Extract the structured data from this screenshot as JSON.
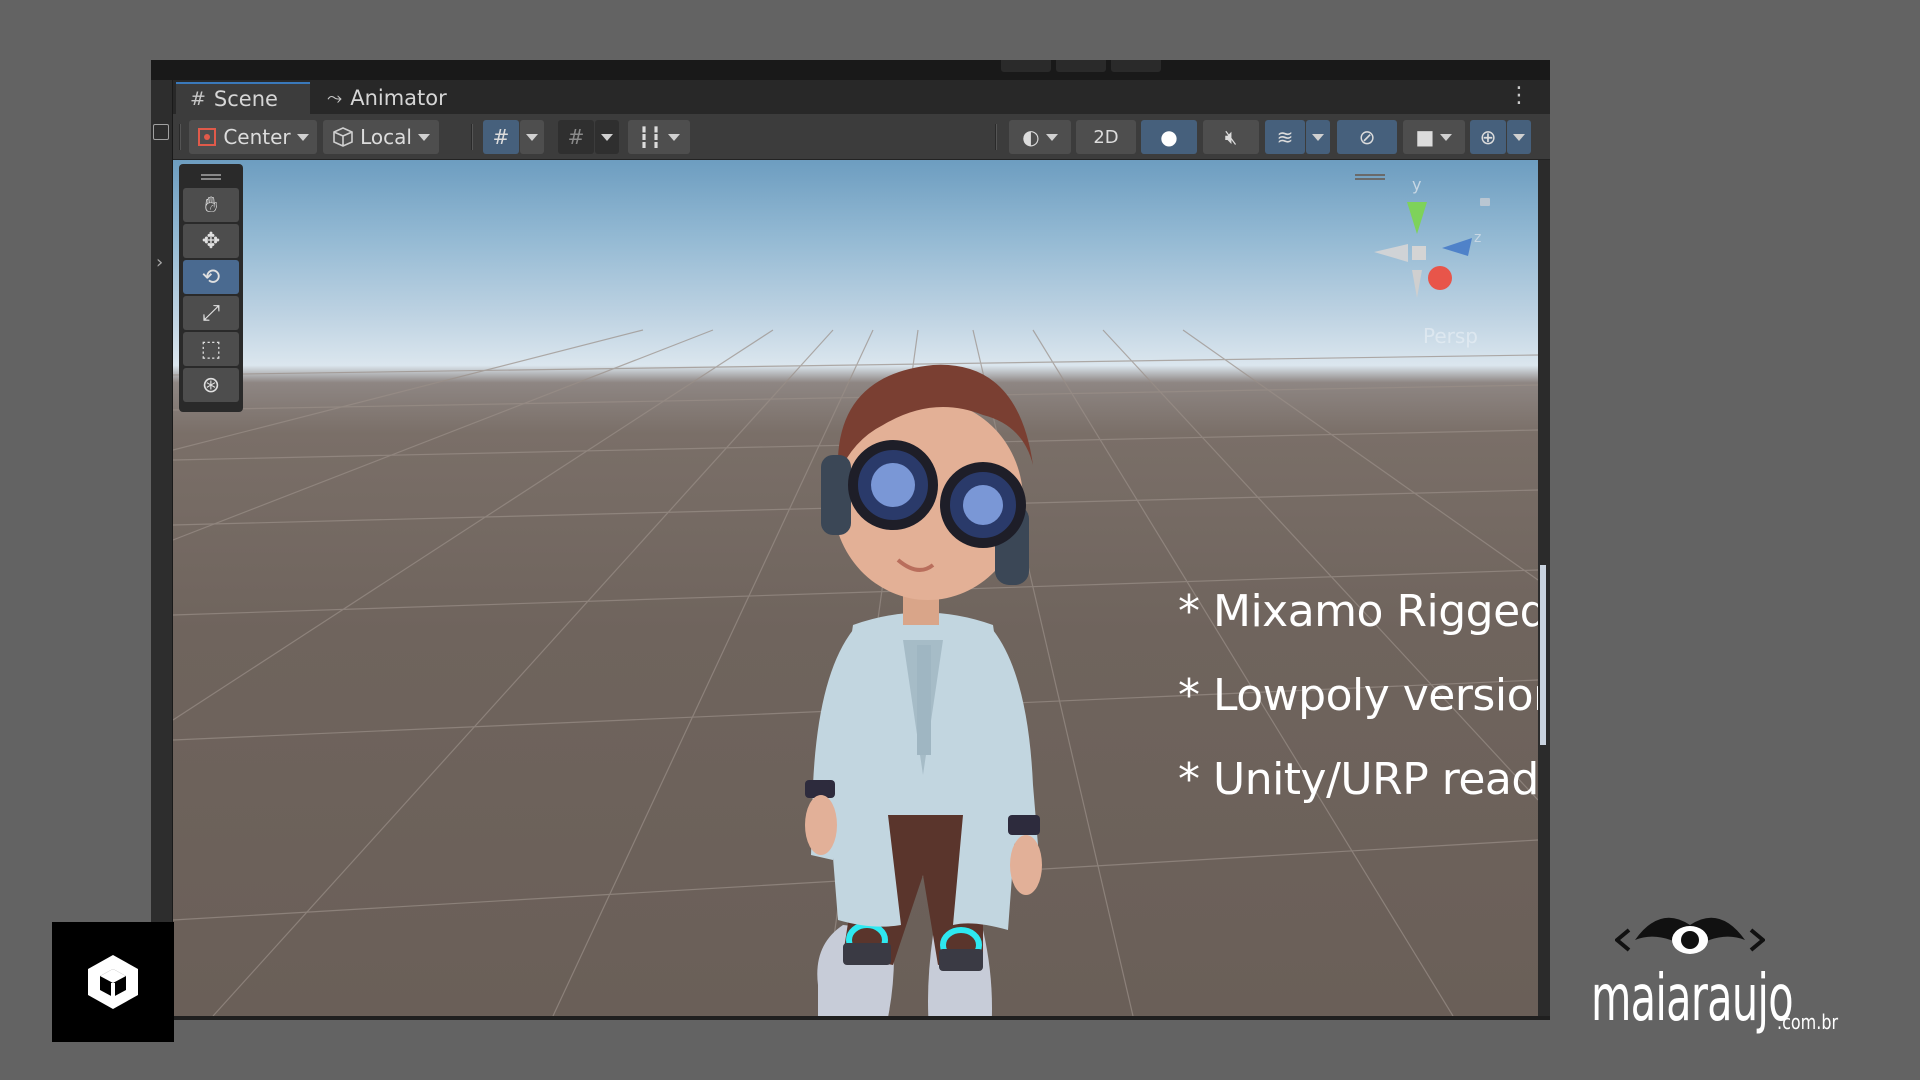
{
  "tabs": [
    {
      "label": "Scene",
      "icon": "grid-icon",
      "active": true
    },
    {
      "label": "Animator",
      "icon": "animator-icon",
      "active": false
    }
  ],
  "toolbar": {
    "pivot_label": "Center",
    "space_label": "Local",
    "mode_2d_label": "2D"
  },
  "scene": {
    "camera_label": "Persp",
    "gizmo_axes": {
      "y": "y",
      "z": "z"
    }
  },
  "features": [
    "* Mixamo Rigged version;",
    "* Lowpoly version;",
    "* Unity/URP ready"
  ],
  "brand": {
    "name": "maiaraujo",
    "domain": ".com.br"
  },
  "colors": {
    "background": "#636363",
    "tab_accent": "#3a79bb",
    "active_tool": "#4a6a90",
    "accent_cyan": "#2ee8f0"
  }
}
